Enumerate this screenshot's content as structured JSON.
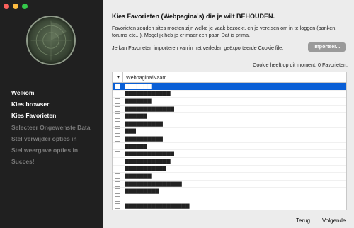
{
  "window": {
    "buttons": [
      "close",
      "minimize",
      "zoom"
    ]
  },
  "sidebar": {
    "logo_icon": "radar-logo-icon",
    "steps": [
      {
        "label": "Welkom",
        "state": "done"
      },
      {
        "label": "Kies browser",
        "state": "done"
      },
      {
        "label": "Kies Favorieten",
        "state": "current"
      },
      {
        "label": "Selecteer Ongewenste Data",
        "state": "pending"
      },
      {
        "label": "Stel verwijder opties in",
        "state": "pending"
      },
      {
        "label": "Stel weergave opties in",
        "state": "pending"
      },
      {
        "label": "Succes!",
        "state": "pending"
      }
    ]
  },
  "main": {
    "title": "Kies Favorieten (Webpagina's) die je wilt BEHOUDEN.",
    "description": "Favorieten zouden sites moeten zijn welke je vaak bezoekt, en je vereisen om in te loggen (banken, forums etc...). Mogelijk heb je er maar een paar. Dat is prima.",
    "import_label": "Je kan Favorieten importeren van in het verleden geëxporteerde Cookie file:",
    "import_button": "Importeer...",
    "cookie_status": "Cookie heeft op dit moment: 0 Favorieten.",
    "table": {
      "heart_icon": "heart-icon",
      "header": "Webpagina/Naam",
      "rows": [
        {
          "site": "▇▇▇▇▇▇▇",
          "selected": true
        },
        {
          "site": "▇▇▇▇▇▇▇▇▇▇▇▇",
          "selected": false
        },
        {
          "site": "▇▇▇▇▇▇▇",
          "selected": false
        },
        {
          "site": "▇▇▇▇▇▇▇▇▇▇▇▇▇",
          "selected": false
        },
        {
          "site": "▇▇▇▇▇▇",
          "selected": false
        },
        {
          "site": "▇▇▇▇▇▇▇▇▇▇",
          "selected": false
        },
        {
          "site": "▇▇▇",
          "selected": false
        },
        {
          "site": "▇▇▇▇▇▇▇▇▇▇",
          "selected": false
        },
        {
          "site": "▇▇▇▇▇▇",
          "selected": false
        },
        {
          "site": "▇▇▇▇▇▇▇▇▇▇▇▇▇",
          "selected": false
        },
        {
          "site": "▇▇▇▇▇▇▇▇▇▇▇▇",
          "selected": false
        },
        {
          "site": "▇▇▇▇▇▇▇▇▇▇▇",
          "selected": false
        },
        {
          "site": "▇▇▇▇▇▇▇",
          "selected": false
        },
        {
          "site": "▇▇▇▇▇▇▇▇▇▇▇▇▇▇▇",
          "selected": false
        },
        {
          "site": "▇▇▇▇▇▇▇▇▇",
          "selected": false
        },
        {
          "site": "",
          "selected": false
        },
        {
          "site": "▇▇▇▇▇▇▇▇▇▇▇▇▇▇▇▇▇",
          "selected": false
        }
      ]
    }
  },
  "footer": {
    "back": "Terug",
    "next": "Volgende"
  },
  "colors": {
    "sidebar_bg": "#202020",
    "content_bg": "#ececec",
    "selection": "#0a5fd6"
  }
}
